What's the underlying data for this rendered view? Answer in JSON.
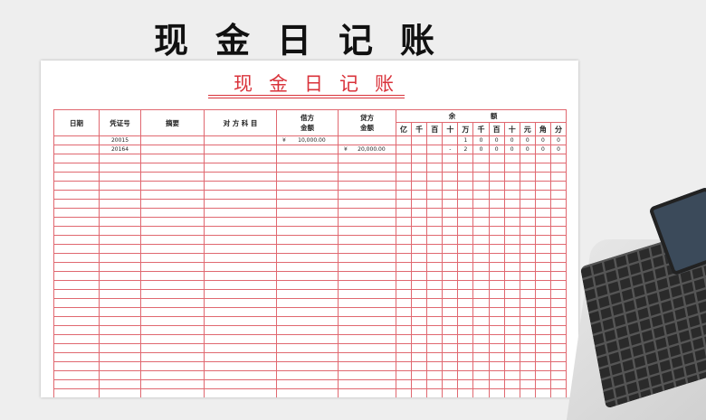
{
  "banner_title": "现金日记账",
  "sheet_title": "现金日记账",
  "headers": {
    "date": "日期",
    "voucher": "凭证号",
    "summary": "摘要",
    "account": "对 方 科 目",
    "debit": "借方\n金额",
    "credit": "贷方\n金额",
    "balance": "余 额",
    "digits": [
      "亿",
      "千",
      "百",
      "十",
      "万",
      "千",
      "百",
      "十",
      "元",
      "角",
      "分"
    ]
  },
  "rows": [
    {
      "voucher": "20015",
      "debit_currency": "¥",
      "debit": "10,000.00",
      "credit_currency": "",
      "credit": "",
      "balance": [
        "",
        "",
        "",
        "",
        "1",
        "0",
        "0",
        "0",
        "0",
        "0",
        "0"
      ]
    },
    {
      "voucher": "20164",
      "debit_currency": "",
      "debit": "",
      "credit_currency": "¥",
      "credit": "20,000.00",
      "balance": [
        "",
        "",
        "",
        "-",
        "2",
        "0",
        "0",
        "0",
        "0",
        "0",
        "0"
      ]
    }
  ],
  "colors": {
    "grid": "#e06870",
    "title_red": "#d9323a"
  },
  "icons": [
    "laptop-icon"
  ]
}
